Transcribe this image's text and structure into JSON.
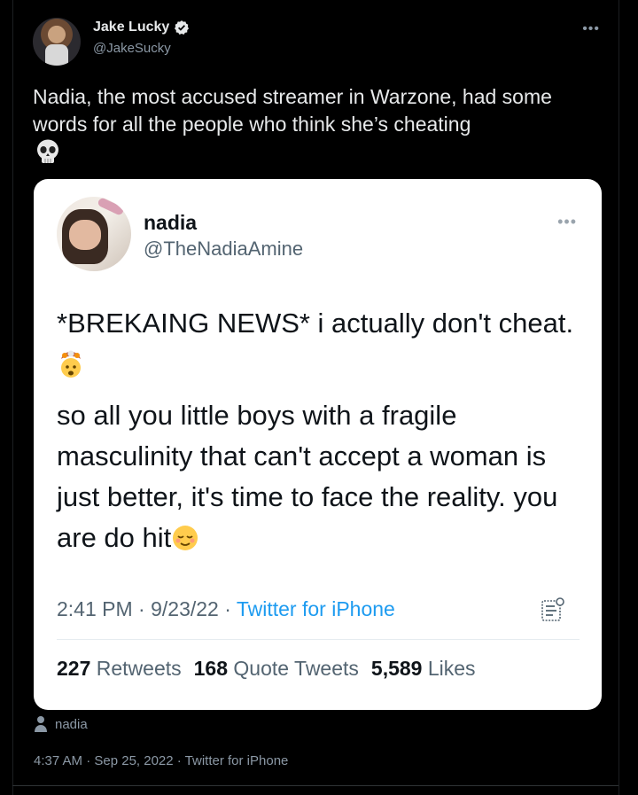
{
  "outer_tweet": {
    "author_name": "Jake Lucky",
    "handle": "@JakeSucky",
    "more_label": "•••",
    "text": "Nadia, the most accused streamer in Warzone, had some words for all the people who think she’s cheating",
    "alt_tag": "nadia",
    "timestamp": "4:37 AM · Sep 25, 2022 · Twitter for iPhone"
  },
  "quoted_tweet": {
    "author_name": "nadia",
    "handle": "@TheNadiaAmine",
    "more_label": "•••",
    "paragraph1": "*BREKAING NEWS* i actually don't cheat.",
    "paragraph2": "so all you little boys with a fragile masculinity that can't accept a woman is just better, it's time to face the reality. you are do hit",
    "time": "2:41 PM · 9/23/22 · ",
    "source": "Twitter for iPhone",
    "retweets_count": "227",
    "retweets_label": "Retweets",
    "quotes_count": "168",
    "quotes_label": "Quote Tweets",
    "likes_count": "5,589",
    "likes_label": "Likes"
  },
  "icons": {
    "verified": "verified-badge-icon",
    "skull": "skull-emoji",
    "exploding_head": "exploding-head-emoji",
    "relieved": "relieved-face-emoji",
    "stats": "tweet-stats-icon",
    "person": "person-icon"
  },
  "colors": {
    "background": "#000000",
    "card": "#ffffff",
    "link_blue": "#1d9bf0",
    "muted": "#8b98a5"
  }
}
